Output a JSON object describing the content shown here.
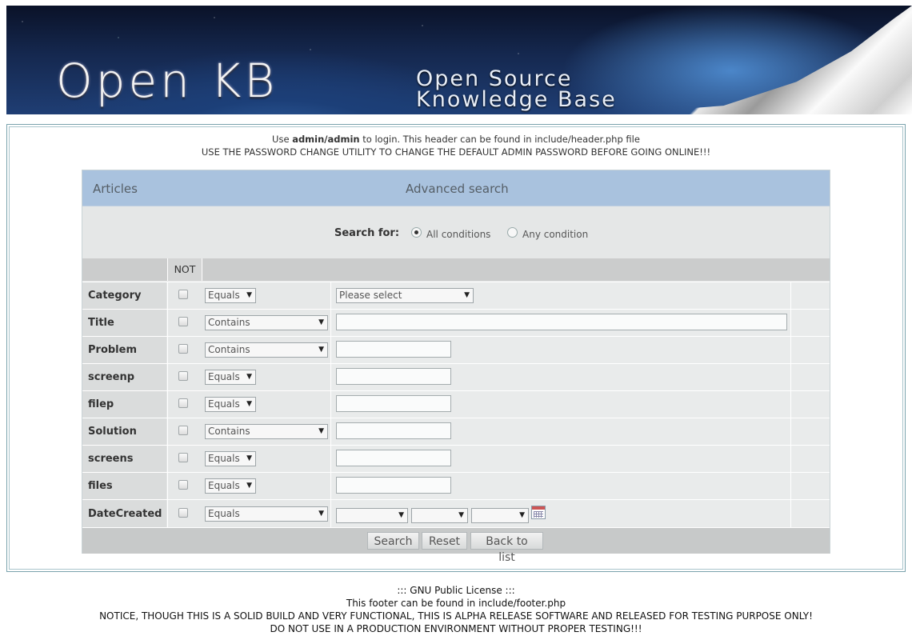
{
  "banner": {
    "logo_text": "Open KB",
    "subtitle_line1": "Open Source",
    "subtitle_line2": "Knowledge Base"
  },
  "notice": {
    "prefix": "Use ",
    "credentials": "admin/admin",
    "suffix": " to login. This header can be found in include/header.php file",
    "warning": "USE THE PASSWORD CHANGE UTILITY TO CHANGE THE DEFAULT ADMIN PASSWORD BEFORE GOING ONLINE!!!"
  },
  "panel": {
    "breadcrumb": "Articles",
    "title": "Advanced search",
    "search_for_label": "Search for:",
    "option_all": "All conditions",
    "option_any": "Any condition",
    "selected_option": "All conditions",
    "not_header": "NOT"
  },
  "fields": [
    {
      "name": "Category",
      "operator": "Equals",
      "value_select": "Please select"
    },
    {
      "name": "Title",
      "operator": "Contains",
      "value": ""
    },
    {
      "name": "Problem",
      "operator": "Contains",
      "value": ""
    },
    {
      "name": "screenp",
      "operator": "Equals",
      "value": ""
    },
    {
      "name": "filep",
      "operator": "Equals",
      "value": ""
    },
    {
      "name": "Solution",
      "operator": "Contains",
      "value": ""
    },
    {
      "name": "screens",
      "operator": "Equals",
      "value": ""
    },
    {
      "name": "files",
      "operator": "Equals",
      "value": ""
    },
    {
      "name": "DateCreated",
      "operator": "Equals",
      "day": "",
      "month": "",
      "year": ""
    }
  ],
  "buttons": {
    "search": "Search",
    "reset": "Reset",
    "back": "Back to list"
  },
  "footer": {
    "license": "::: GNU Public License :::",
    "location": "This footer can be found in include/footer.php",
    "notice1": "NOTICE, THOUGH THIS IS A SOLID BUILD AND VERY FUNCTIONAL, THIS IS ALPHA RELEASE SOFTWARE AND RELEASED FOR TESTING PURPOSE ONLY!",
    "notice2": "DO NOT USE IN A PRODUCTION ENVIRONMENT WITHOUT PROPER TESTING!!!"
  },
  "icons": {
    "calendar": "calendar-icon",
    "dropdown": "chevron-down-icon"
  },
  "colors": {
    "header_bar": "#a9c2de",
    "panel_bg": "#e5e7e7",
    "frame_border": "#7aa3ad"
  }
}
